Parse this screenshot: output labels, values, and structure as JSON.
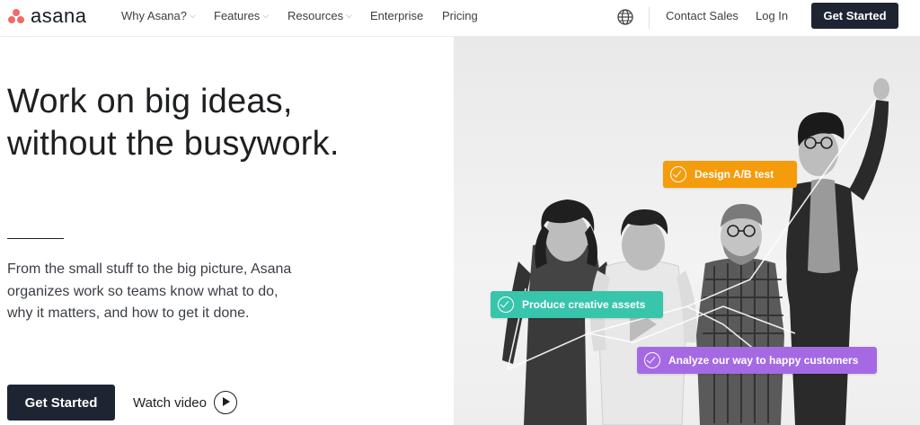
{
  "brand": {
    "name": "asana",
    "dot_color": "#f06a6a"
  },
  "nav": {
    "items": [
      {
        "label": "Why Asana?",
        "dropdown": true
      },
      {
        "label": "Features",
        "dropdown": true
      },
      {
        "label": "Resources",
        "dropdown": true
      },
      {
        "label": "Enterprise",
        "dropdown": false
      },
      {
        "label": "Pricing",
        "dropdown": false
      }
    ],
    "globe_icon": "globe-icon",
    "contact_sales": "Contact Sales",
    "log_in": "Log In",
    "get_started": "Get Started"
  },
  "hero": {
    "title_line1": "Work on big ideas,",
    "title_line2": "without the busywork.",
    "description": "From the small stuff to the big picture, Asana organizes work so teams know what to do, why it matters, and how to get it done.",
    "cta": "Get Started",
    "watch_video": "Watch video"
  },
  "tasks": [
    {
      "label": "Design A/B test",
      "color": "#f59c0c"
    },
    {
      "label": "Produce creative assets",
      "color": "#37c5ab"
    },
    {
      "label": "Analyze our way to happy customers",
      "color": "#a56ae3"
    }
  ],
  "colors": {
    "dark_button": "#1e2432",
    "text": "#1e1f21"
  }
}
